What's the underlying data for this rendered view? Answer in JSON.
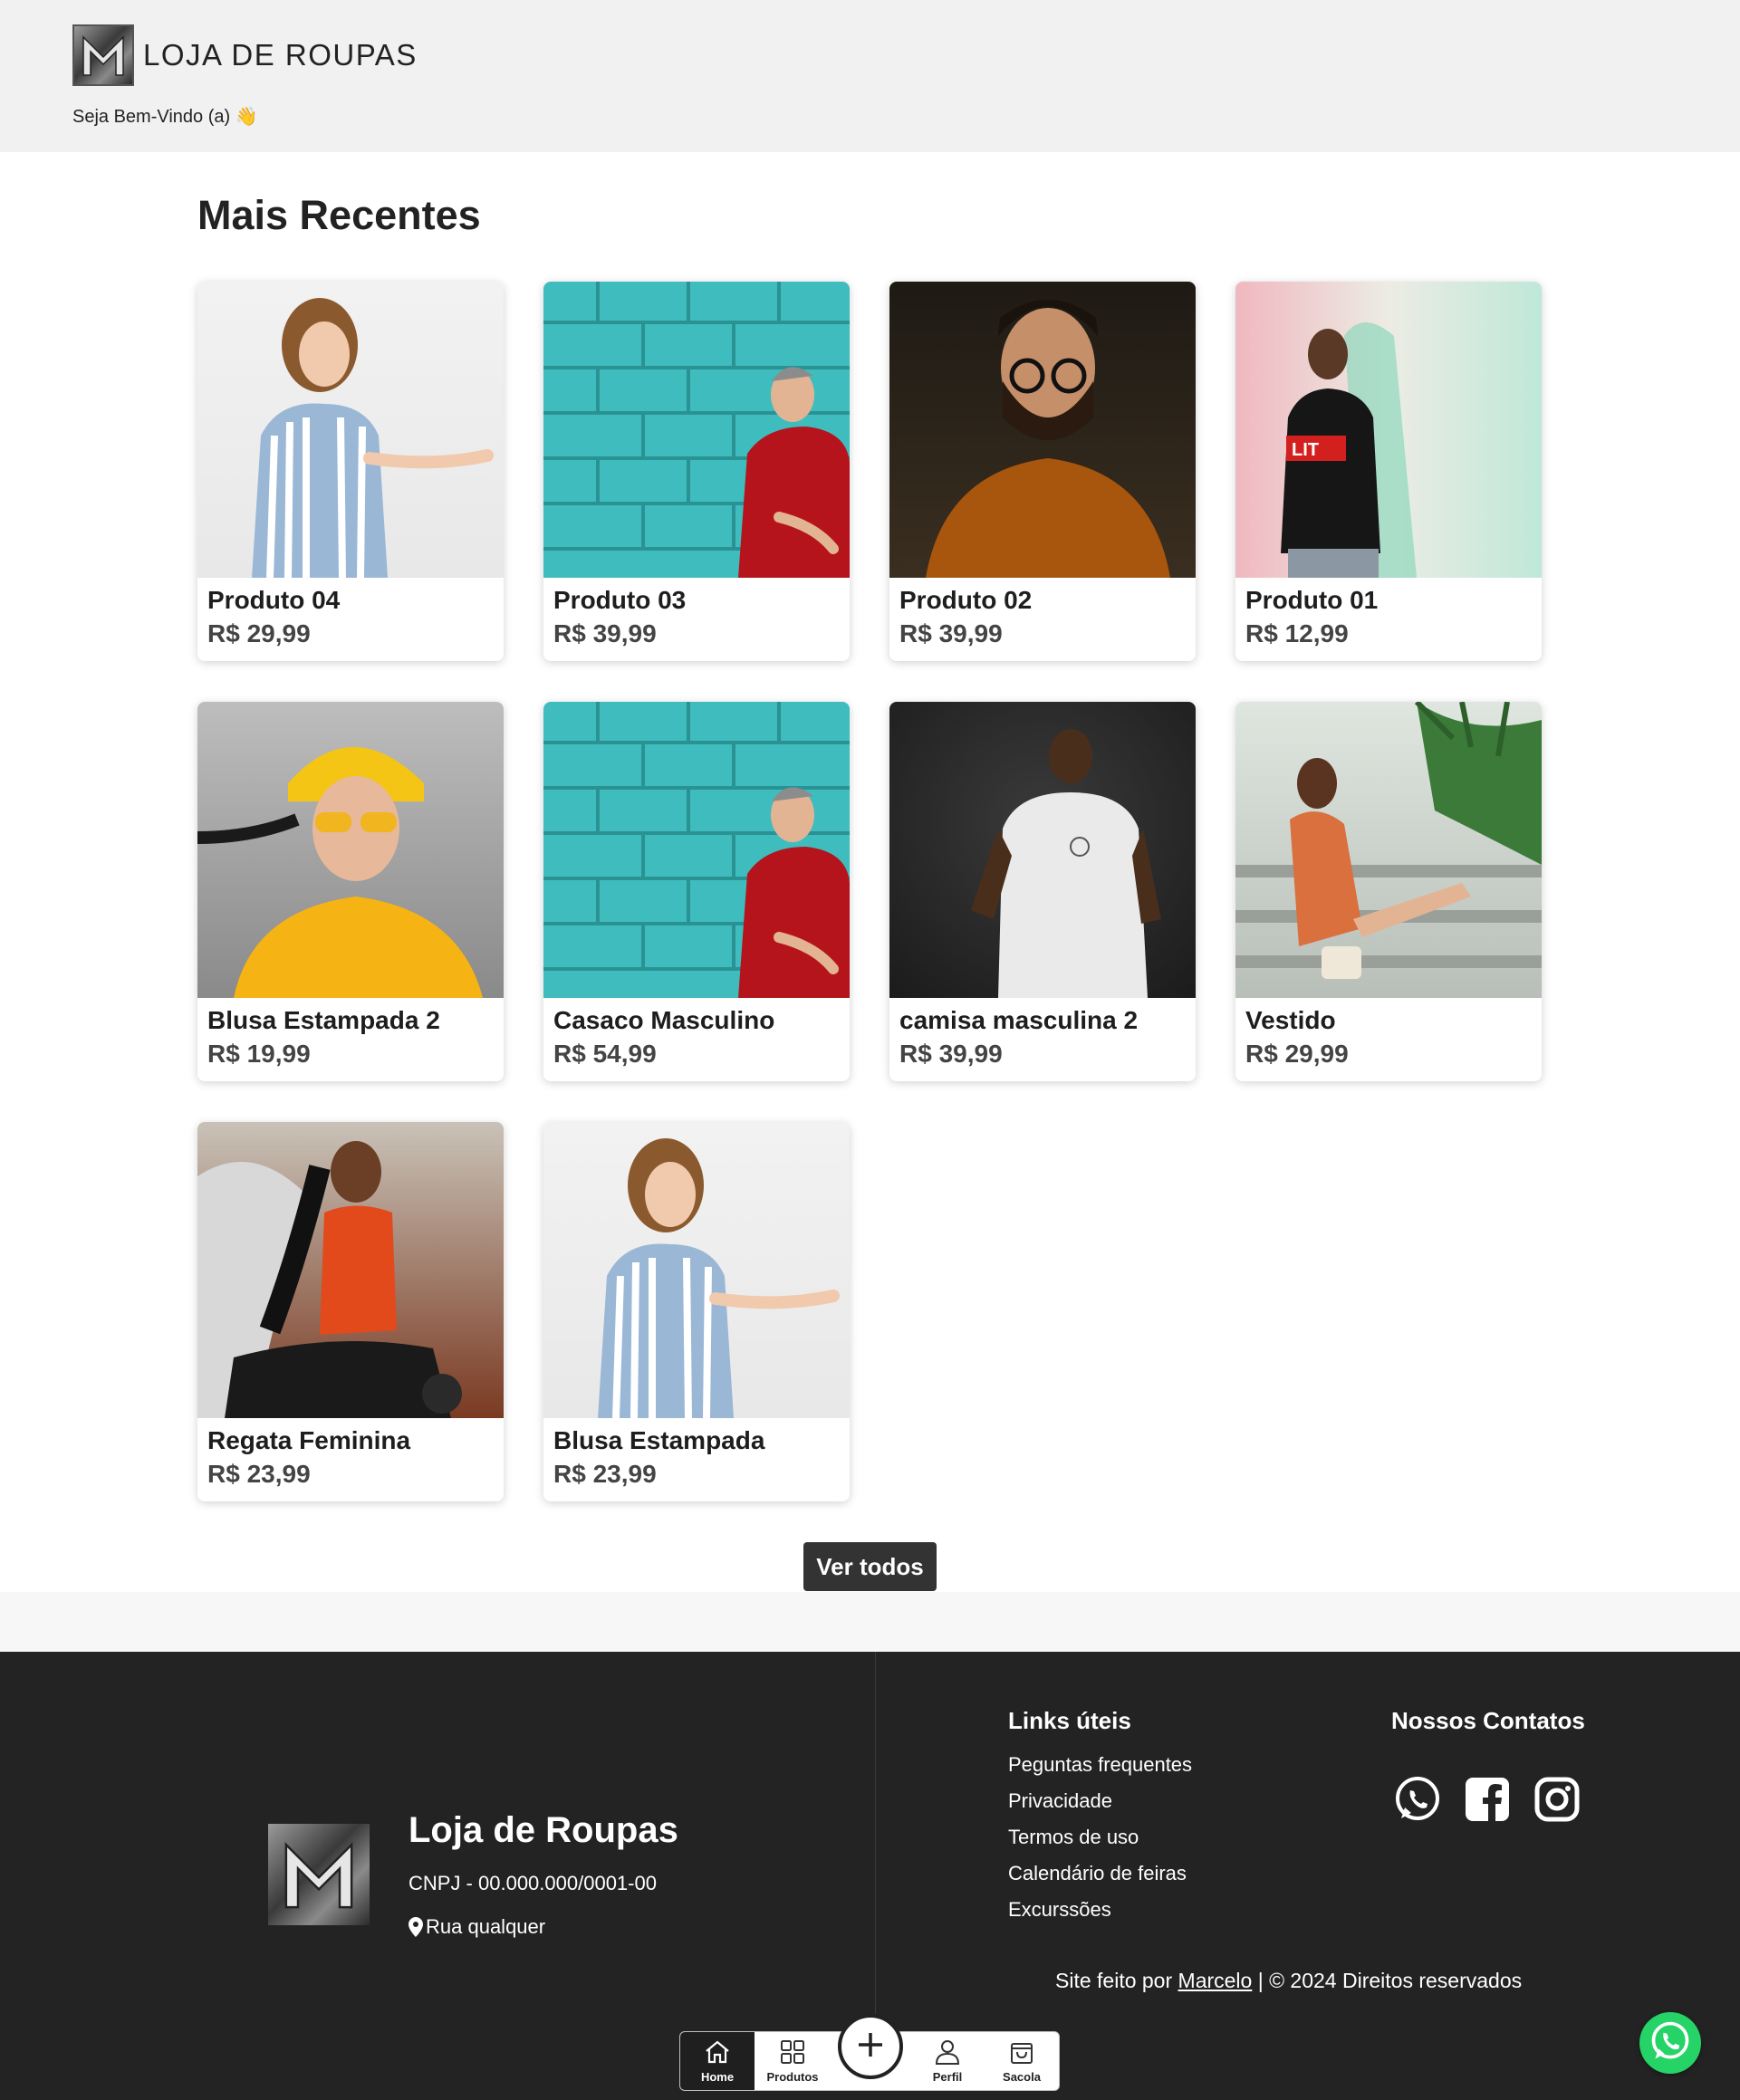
{
  "header": {
    "title": "LOJA DE ROUPAS",
    "welcome": "Seja Bem-Vindo (a) 👋"
  },
  "main": {
    "section_title": "Mais Recentes",
    "products": [
      {
        "name": "Produto 04",
        "price": "R$ 29,99"
      },
      {
        "name": "Produto 03",
        "price": "R$ 39,99"
      },
      {
        "name": "Produto 02",
        "price": "R$ 39,99"
      },
      {
        "name": "Produto 01",
        "price": "R$ 12,99"
      },
      {
        "name": "Blusa Estampada 2",
        "price": "R$ 19,99"
      },
      {
        "name": "Casaco Masculino",
        "price": "R$ 54,99"
      },
      {
        "name": "camisa masculina 2",
        "price": "R$ 39,99"
      },
      {
        "name": "Vestido",
        "price": "R$ 29,99"
      },
      {
        "name": "Regata Feminina",
        "price": "R$ 23,99"
      },
      {
        "name": "Blusa Estampada",
        "price": "R$ 23,99"
      }
    ],
    "see_all_label": "Ver todos"
  },
  "footer": {
    "store_name": "Loja de Roupas",
    "cnpj": "CNPJ - 00.000.000/0001-00",
    "address": "Rua qualquer",
    "links_title": "Links úteis",
    "links": [
      "Peguntas frequentes",
      "Privacidade",
      "Termos de uso",
      "Calendário de feiras",
      "Excurssões"
    ],
    "contacts_title": "Nossos Contatos",
    "credits_prefix": "Site feito por",
    "credits_author": "Marcelo",
    "credits_suffix": "| © 2024 Direitos reservados"
  },
  "bottom_nav": {
    "items": [
      "Home",
      "Produtos",
      "Perfil",
      "Sacola"
    ]
  },
  "colors": {
    "header_bg": "#f1f1f1",
    "footer_bg": "#232323",
    "button_bg": "#333333",
    "whatsapp": "#25D366"
  }
}
